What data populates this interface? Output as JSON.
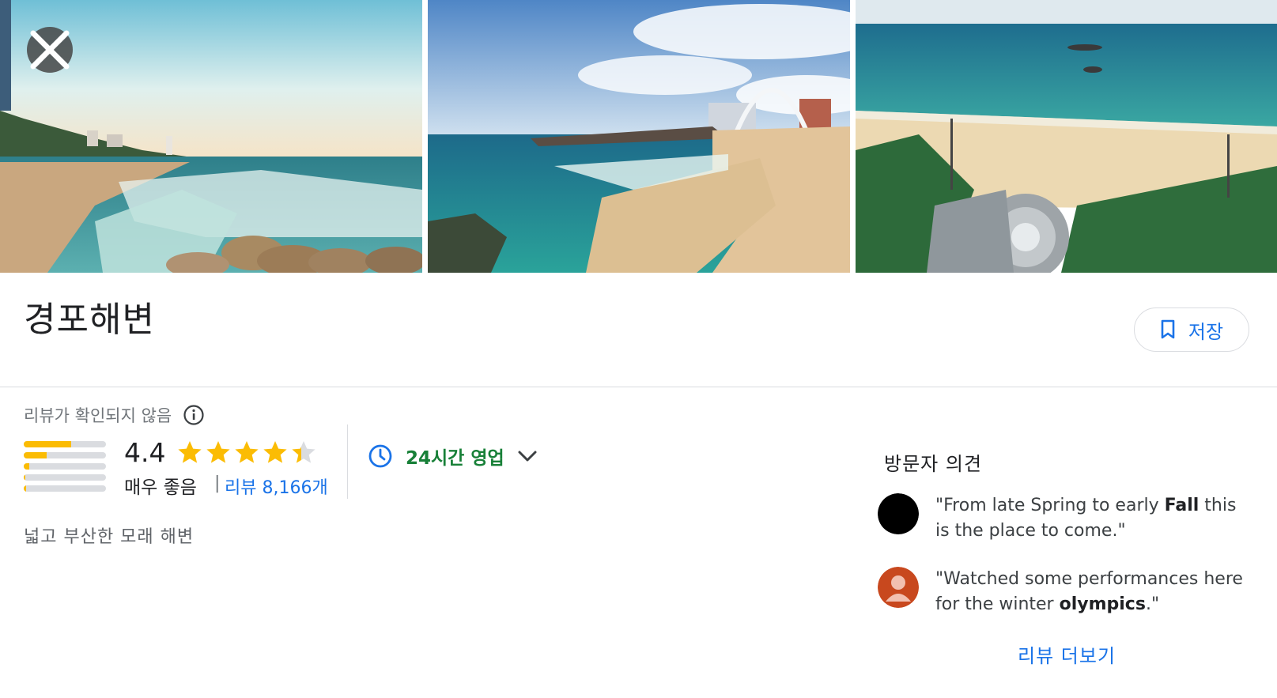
{
  "place": {
    "name": "경포해변",
    "save_label": "저장"
  },
  "rating": {
    "unverified_text": "리뷰가 확인되지 않음",
    "average": "4.4",
    "stars_value": 4.4,
    "label": "매우 좋음",
    "separator": "|",
    "reviews_link": "리뷰 8,166개",
    "distribution": [
      0.58,
      0.28,
      0.07,
      0.02,
      0.03
    ]
  },
  "hours": {
    "status": "24시간 영업"
  },
  "description": "넓고 부산한 모래 해변",
  "opinions": {
    "heading": "방문자 의견",
    "items": [
      {
        "pre": "\"From late Spring to early ",
        "bold": "Fall",
        "post": " this is the place to come.\""
      },
      {
        "pre": "\"Watched some performances here for the winter ",
        "bold": "olympics",
        "post": ".\""
      }
    ],
    "more_label": "리뷰 더보기"
  },
  "icons": {
    "close": "close-icon",
    "bookmark": "bookmark-icon",
    "info": "info-icon",
    "clock": "clock-icon",
    "expand": "chevron-down-icon"
  },
  "colors": {
    "accent_blue": "#1a73e8",
    "open_green": "#188038",
    "star_yellow": "#fbbc04"
  }
}
